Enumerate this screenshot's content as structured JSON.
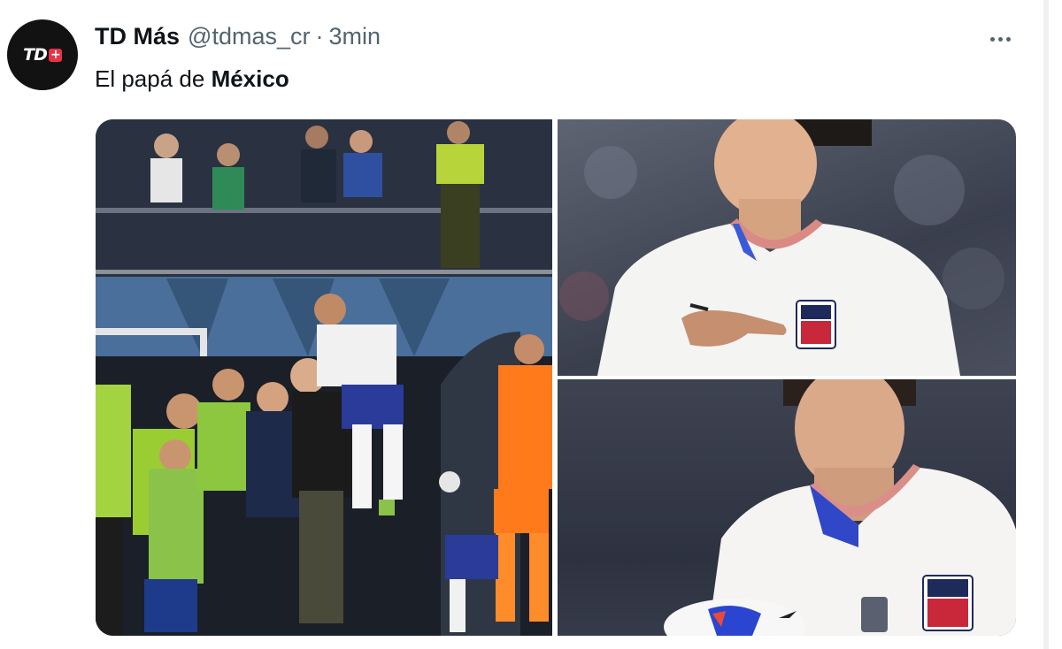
{
  "tweet": {
    "author": {
      "display_name": "TD Más",
      "handle": "@tdmas_cr",
      "avatar_logo": "TD",
      "avatar_plus": "+"
    },
    "separator": "·",
    "time": "3min",
    "more_icon": "more-horizontal-icon",
    "text": {
      "prefix": "El papá de ",
      "bold": "México"
    },
    "media": [
      {
        "label": "Photo: players celebrating near the bench"
      },
      {
        "label": "Photo: player in white USA jersey pointing at crest"
      },
      {
        "label": "Photo: player in white USA jersey holding a ball"
      }
    ]
  }
}
